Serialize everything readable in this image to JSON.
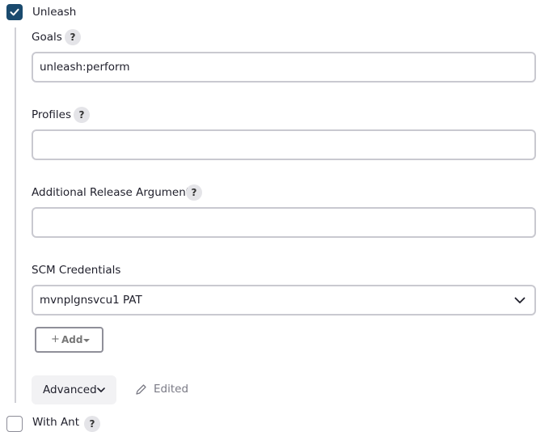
{
  "unleash": {
    "label": "Unleash",
    "checked": true
  },
  "goals": {
    "label": "Goals",
    "help": "?",
    "value": "unleash:perform"
  },
  "profiles": {
    "label": "Profiles",
    "help": "?",
    "value": ""
  },
  "release_args": {
    "label": "Additional Release Arguments",
    "help": "?",
    "value": ""
  },
  "scm": {
    "label": "SCM Credentials",
    "selected": "mvnplgnsvcu1 PAT"
  },
  "add_button": {
    "plus": "+",
    "label": "Add"
  },
  "advanced": {
    "label": "Advanced",
    "edited_label": "Edited"
  },
  "with_ant": {
    "label": "With Ant",
    "help": "?",
    "checked": false
  }
}
